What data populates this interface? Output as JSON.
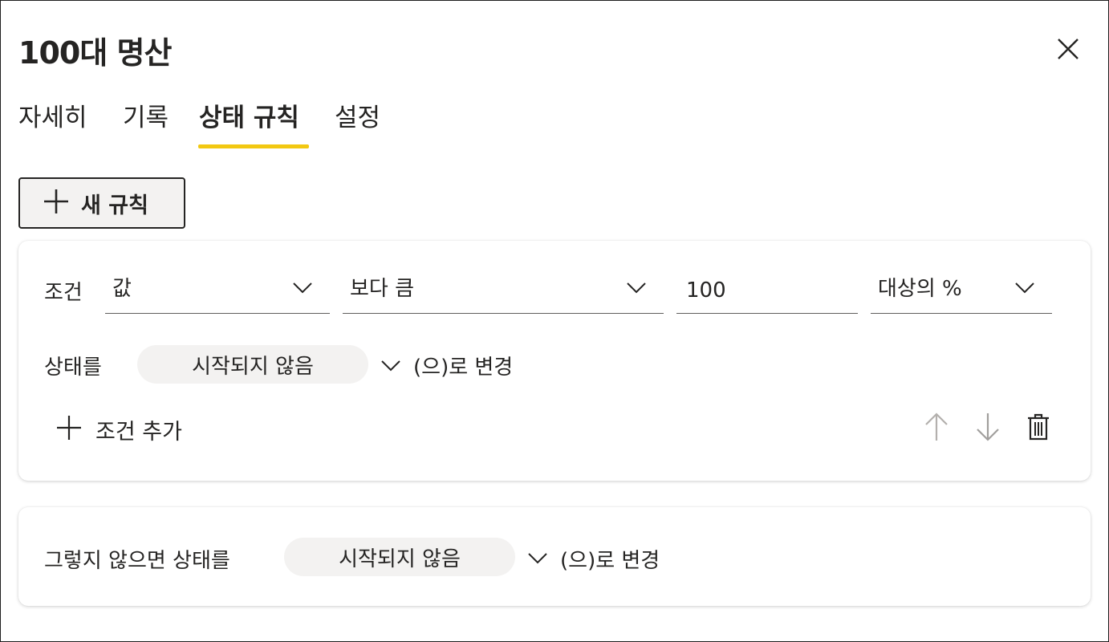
{
  "window": {
    "title": "100대 명산",
    "close_icon": "close-icon"
  },
  "tabs": [
    {
      "label": "자세히",
      "active": false
    },
    {
      "label": "기록",
      "active": false
    },
    {
      "label": "상태 규칙",
      "active": true
    },
    {
      "label": "설정",
      "active": false
    }
  ],
  "accent_color": "#f2c811",
  "toolbar": {
    "new_rule_label": "새 규칙",
    "new_rule_icon": "plus-icon"
  },
  "rule": {
    "condition_label": "조건",
    "field_dropdown": {
      "value": "값"
    },
    "operator_dropdown": {
      "value": "보다 큼"
    },
    "threshold_input": {
      "value": "100",
      "placeholder": ""
    },
    "unit_dropdown": {
      "value": "대상의 %"
    },
    "status_prefix": "상태를",
    "status_value": "시작되지 않음",
    "status_suffix": "(으)로 변경",
    "add_condition_label": "조건 추가",
    "actions": {
      "move_up_icon": "arrow-up-icon",
      "move_down_icon": "arrow-down-icon",
      "delete_icon": "trash-icon"
    }
  },
  "otherwise": {
    "prefix": "그렇지 않으면 상태를",
    "status_value": "시작되지 않음",
    "suffix": "(으)로 변경"
  }
}
